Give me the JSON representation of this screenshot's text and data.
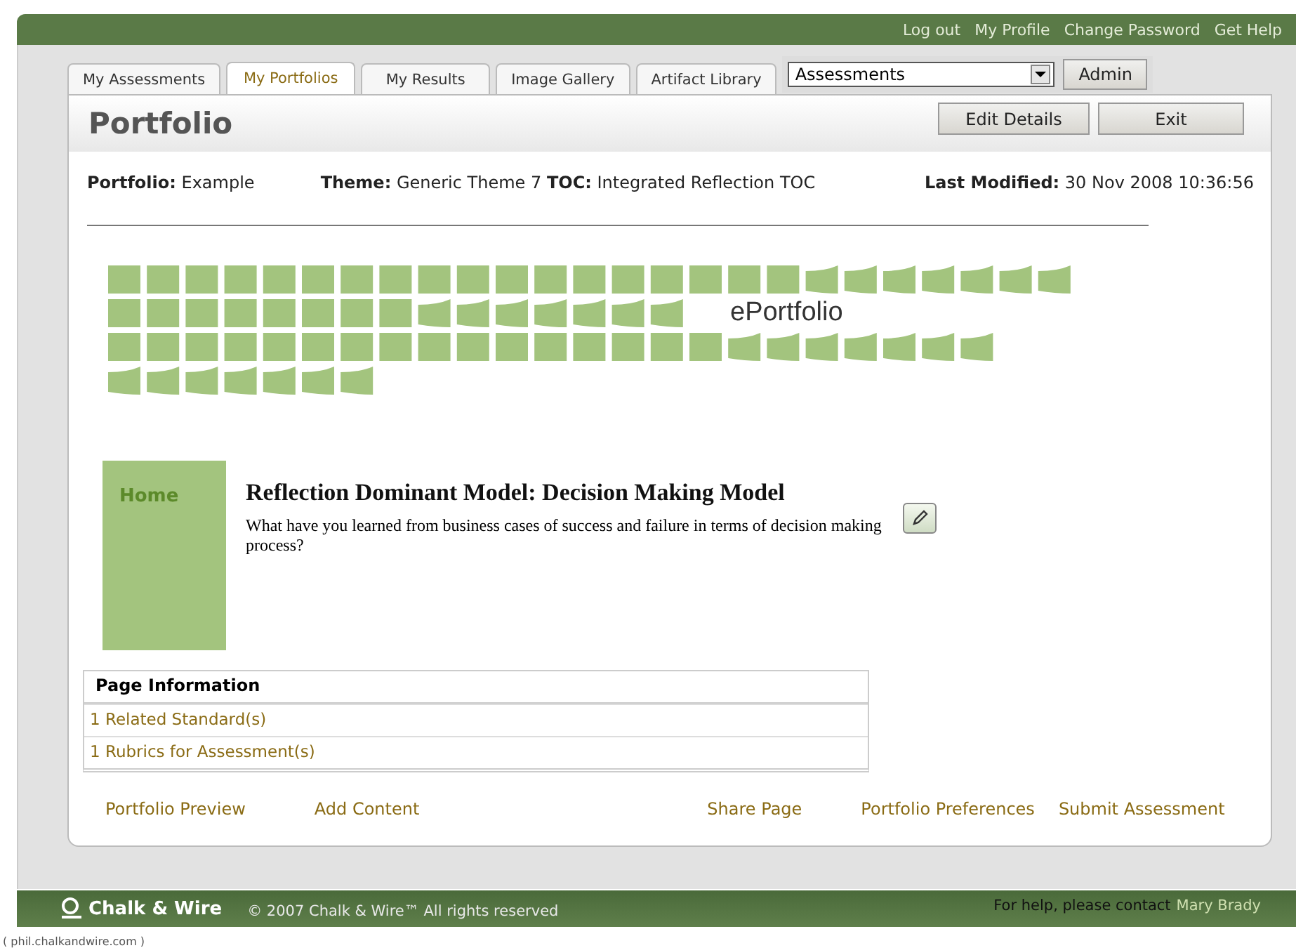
{
  "top_links": [
    "Log out",
    "My Profile",
    "Change Password",
    "Get Help"
  ],
  "tabs": [
    {
      "label": "My Assessments",
      "selected": false
    },
    {
      "label": "My Portfolios",
      "selected": true
    },
    {
      "label": "My Results",
      "selected": false
    },
    {
      "label": "Image Gallery",
      "selected": false
    },
    {
      "label": "Artifact Library",
      "selected": false
    }
  ],
  "role_select": {
    "value": "Assessments"
  },
  "admin_button": "Admin",
  "header": {
    "title": "Portfolio",
    "buttons": [
      "Edit Details",
      "Exit"
    ]
  },
  "meta": [
    {
      "label": "Portfolio:",
      "value": "Example"
    },
    {
      "label": "Theme:",
      "value": "Generic Theme 7"
    },
    {
      "label": "TOC:",
      "value": "Integrated Reflection TOC"
    },
    {
      "label": "Last Modified:",
      "value": "30 Nov 2008 10:36:56"
    }
  ],
  "banner": {
    "text": "ePortfolio"
  },
  "nav": {
    "items": [
      {
        "label": "Home"
      }
    ]
  },
  "content": {
    "title": "Reflection Dominant Model: Decision Making Model",
    "body": "What have you learned from business cases of success and failure in terms of decision making process?"
  },
  "page_information": {
    "title": "Page Information",
    "links": [
      "1 Related Standard(s)",
      "1 Rubrics for Assessment(s)"
    ]
  },
  "actions": [
    "Portfolio Preview",
    "Add Content",
    "Share Page",
    "Portfolio Preferences",
    "Submit Assessment"
  ],
  "footer": {
    "brand": "Chalk & Wire",
    "copyright": "© 2007  Chalk & Wire™  All rights reserved",
    "help_text": "For help, please contact",
    "help_link": "Mary Brady"
  },
  "status_url": "( phil.chalkandwire.com )"
}
